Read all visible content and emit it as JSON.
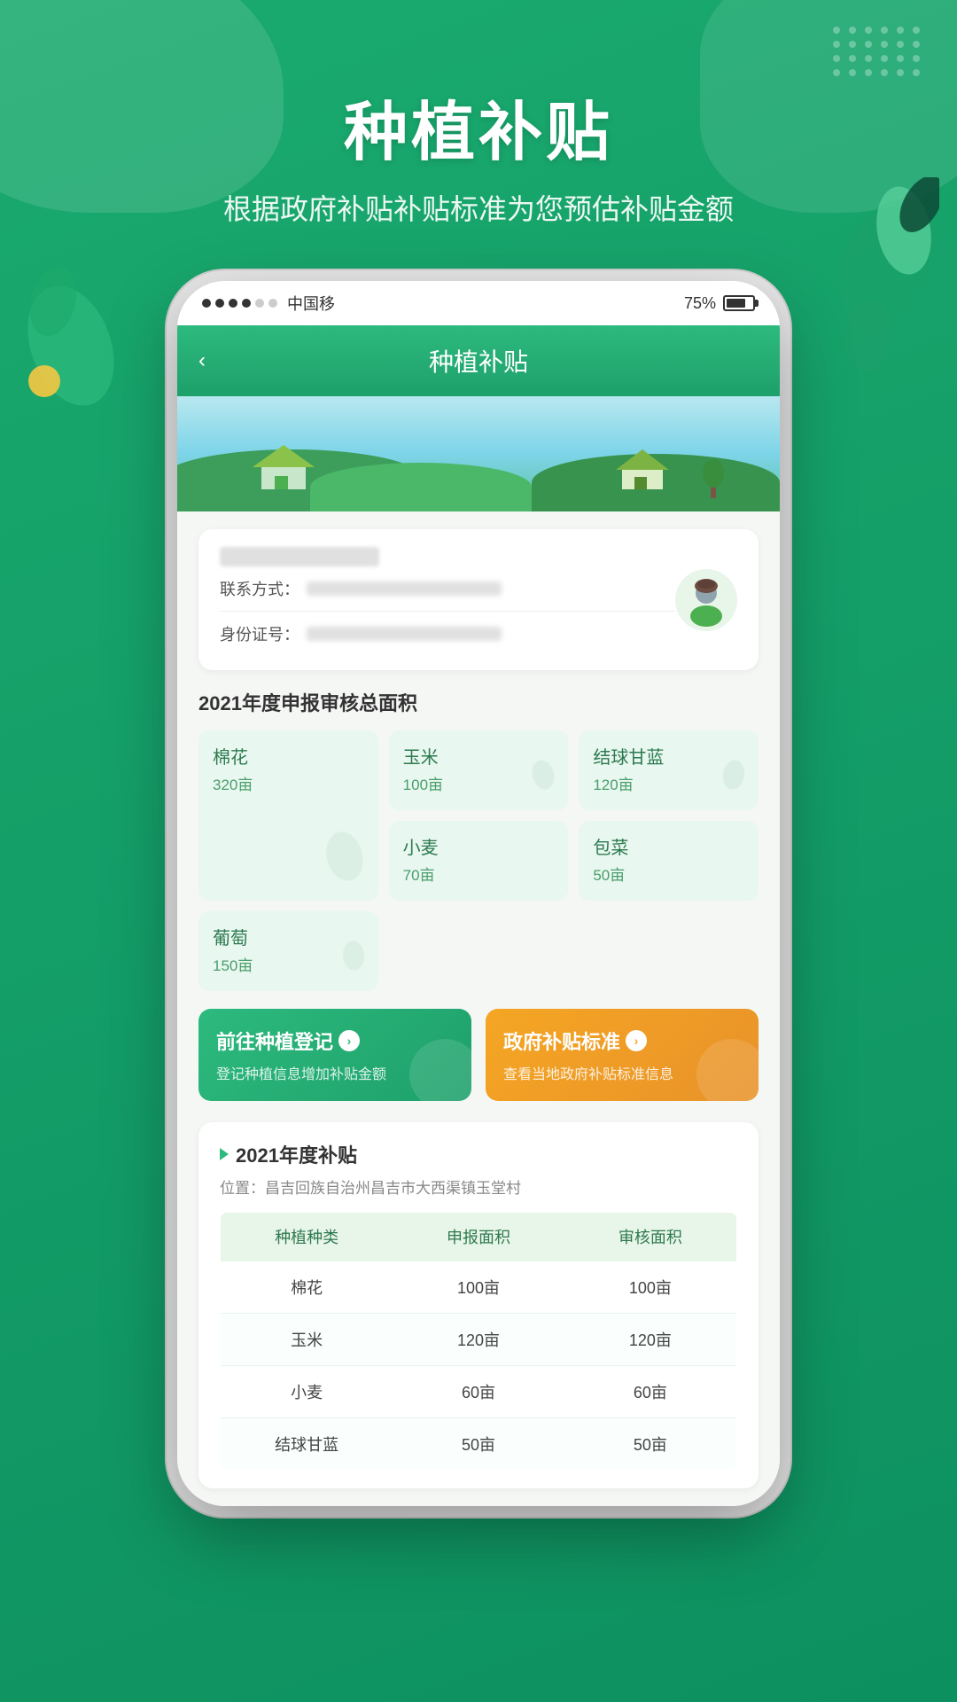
{
  "app": {
    "mainTitle": "种植补贴",
    "subTitle": "根据政府补贴补贴标准为您预估补贴金额",
    "backLabel": "‹",
    "appTitle": "种植补贴"
  },
  "statusBar": {
    "carrier": "中国移",
    "battery": "75%",
    "signals": [
      "filled",
      "filled",
      "filled",
      "filled",
      "empty",
      "empty"
    ]
  },
  "userCard": {
    "contactLabel": "联系方式：",
    "idLabel": "身份证号："
  },
  "areaSection": {
    "title": "2021年度申报审核总面积",
    "crops": [
      {
        "name": "棉花",
        "area": "320亩",
        "large": true
      },
      {
        "name": "玉米",
        "area": "100亩",
        "large": false
      },
      {
        "name": "结球甘蓝",
        "area": "120亩",
        "large": false
      },
      {
        "name": "小麦",
        "area": "70亩",
        "large": false
      },
      {
        "name": "包菜",
        "area": "50亩",
        "large": false
      },
      {
        "name": "葡萄",
        "area": "150亩",
        "large": false
      }
    ]
  },
  "actionButtons": [
    {
      "title": "前往种植登记",
      "desc": "登记种植信息增加补贴金额",
      "type": "green"
    },
    {
      "title": "政府补贴标准",
      "desc": "查看当地政府补贴标准信息",
      "type": "orange"
    }
  ],
  "subsidySection": {
    "title": "2021年度补贴",
    "location": "位置：昌吉回族自治州昌吉市大西渠镇玉堂村",
    "tableHeaders": [
      "种植种类",
      "申报面积",
      "审核面积"
    ],
    "tableRows": [
      [
        "棉花",
        "100亩",
        "100亩"
      ],
      [
        "玉米",
        "120亩",
        "120亩"
      ],
      [
        "小麦",
        "60亩",
        "60亩"
      ],
      [
        "结球甘蓝",
        "50亩",
        "50亩"
      ]
    ]
  },
  "dots": [
    1,
    2,
    3,
    4,
    5,
    6,
    7,
    8,
    9,
    10,
    11,
    12,
    13,
    14,
    15,
    16,
    17,
    18,
    19,
    20,
    21,
    22,
    23,
    24
  ]
}
